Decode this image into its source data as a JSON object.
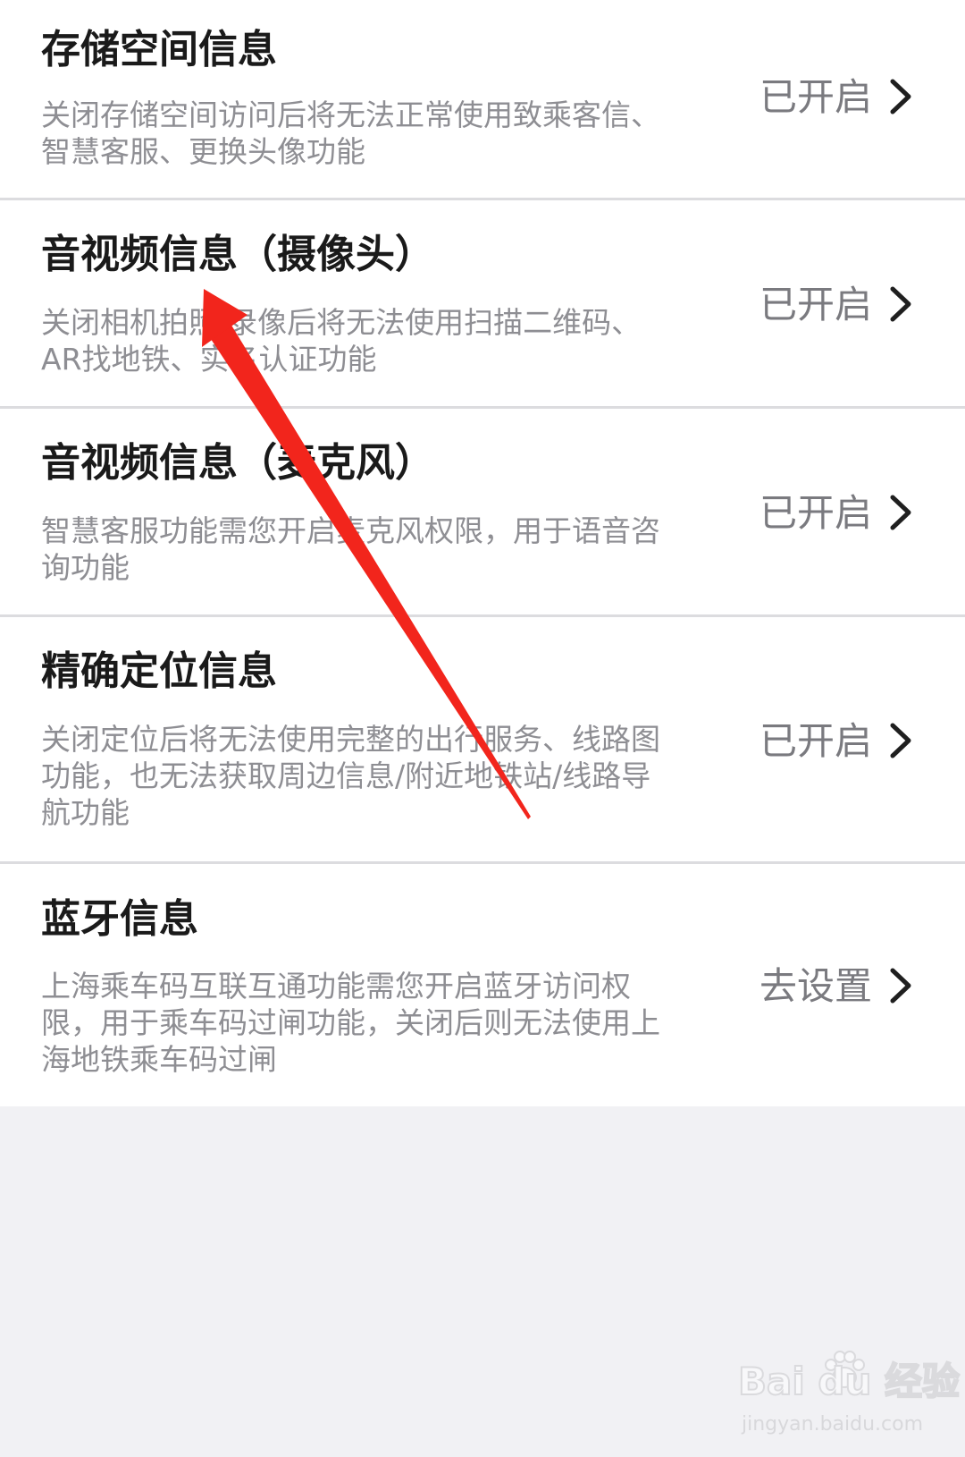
{
  "permissions": [
    {
      "id": "storage",
      "title": "存储空间信息",
      "description": "关闭存储空间访问后将无法正常使用致乘客信、\n智慧客服、更换头像功能",
      "status": "已开启"
    },
    {
      "id": "camera",
      "title": "音视频信息（摄像头）",
      "description": "关闭相机拍照/录像后将无法使用扫描二维码、\nAR找地铁、实名认证功能",
      "status": "已开启"
    },
    {
      "id": "mic",
      "title": "音视频信息（麦克风）",
      "description": "智慧客服功能需您开启麦克风权限，用于语音咨\n询功能",
      "status": "已开启"
    },
    {
      "id": "location",
      "title": "精确定位信息",
      "description": "关闭定位后将无法使用完整的出行服务、线路图\n功能，也无法获取周边信息/附近地铁站/线路导\n航功能",
      "status": "已开启"
    },
    {
      "id": "bluetooth",
      "title": "蓝牙信息",
      "description": "上海乘车码互联互通功能需您开启蓝牙访问权\n限，用于乘车码过闸功能，关闭后则无法使用上\n海地铁乘车码过闸",
      "status": "去设置"
    }
  ],
  "icons": {
    "row_chevron": "chevron-right-icon",
    "annotation": "red-arrow-icon",
    "watermark_paw": "paw-icon"
  },
  "colors": {
    "annotation_arrow": "#f2251c",
    "background": "#f1f1f4",
    "list_background": "#ffffff"
  },
  "watermark": {
    "logo_text": "Bai du 经验",
    "url": "jingyan.baidu.com"
  }
}
